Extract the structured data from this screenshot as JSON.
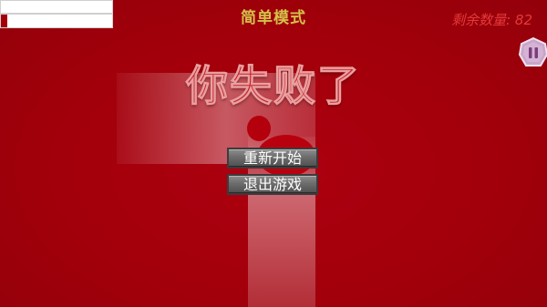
{
  "mode_title": "简单模式",
  "remaining": "剩余数量: 82",
  "top_bars": {
    "bar_1_fill": 1.0,
    "bar_2_fill": 0.06
  },
  "result_title": "你失败了",
  "menu": {
    "restart_label": "重新开始",
    "exit_label": "退出游戏"
  },
  "pause_icon": "pause-icon",
  "colors": {
    "background": "#a3000a",
    "title": "#d4c24a",
    "counter": "#e53a3a",
    "fail_text": "#c8202a",
    "pause_badge": "#c9a6c9"
  }
}
